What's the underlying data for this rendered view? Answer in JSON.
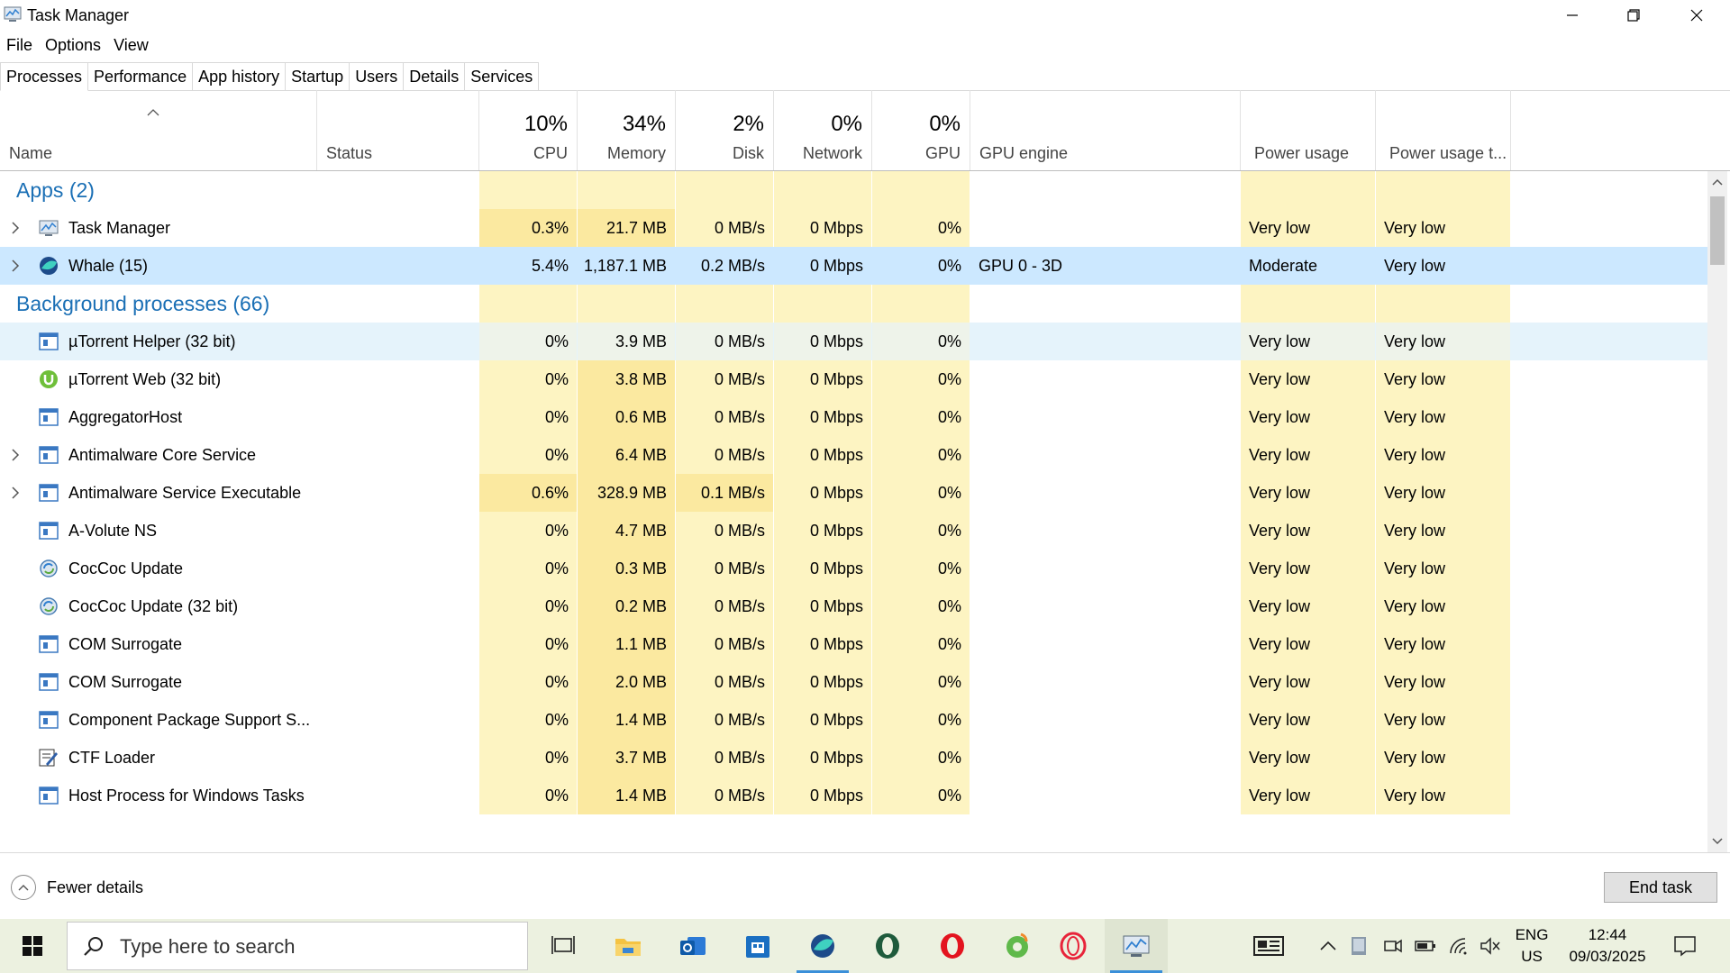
{
  "window": {
    "title": "Task Manager"
  },
  "menu": [
    "File",
    "Options",
    "View"
  ],
  "tabs": [
    "Processes",
    "Performance",
    "App history",
    "Startup",
    "Users",
    "Details",
    "Services"
  ],
  "columns": {
    "name": "Name",
    "status": "Status",
    "cpu": {
      "pct": "10%",
      "label": "CPU"
    },
    "memory": {
      "pct": "34%",
      "label": "Memory"
    },
    "disk": {
      "pct": "2%",
      "label": "Disk"
    },
    "network": {
      "pct": "0%",
      "label": "Network"
    },
    "gpu": {
      "pct": "0%",
      "label": "GPU"
    },
    "gpu_engine": "GPU engine",
    "power": "Power usage",
    "power_trend": "Power usage t..."
  },
  "groups": {
    "apps": "Apps (2)",
    "background": "Background processes (66)"
  },
  "apps": [
    {
      "name": "Task Manager",
      "icon": "task-manager-icon",
      "expandable": true,
      "cpu": "0.3%",
      "mem": "21.7 MB",
      "disk": "0 MB/s",
      "net": "0 Mbps",
      "gpu": "0%",
      "engine": "",
      "power": "Very low",
      "trend": "Very low"
    },
    {
      "name": "Whale (15)",
      "icon": "whale-browser-icon",
      "expandable": true,
      "selected": true,
      "cpu": "5.4%",
      "mem": "1,187.1 MB",
      "disk": "0.2 MB/s",
      "net": "0 Mbps",
      "gpu": "0%",
      "engine": "GPU 0 - 3D",
      "power": "Moderate",
      "trend": "Very low"
    }
  ],
  "background": [
    {
      "name": "µTorrent Helper (32 bit)",
      "icon": "service-window-icon",
      "expandable": false,
      "hover": true,
      "cpu": "0%",
      "mem": "3.9 MB",
      "disk": "0 MB/s",
      "net": "0 Mbps",
      "gpu": "0%",
      "engine": "",
      "power": "Very low",
      "trend": "Very low"
    },
    {
      "name": "µTorrent Web (32 bit)",
      "icon": "utorrent-icon",
      "expandable": false,
      "cpu": "0%",
      "mem": "3.8 MB",
      "disk": "0 MB/s",
      "net": "0 Mbps",
      "gpu": "0%",
      "engine": "",
      "power": "Very low",
      "trend": "Very low"
    },
    {
      "name": "AggregatorHost",
      "icon": "service-window-icon",
      "expandable": false,
      "cpu": "0%",
      "mem": "0.6 MB",
      "disk": "0 MB/s",
      "net": "0 Mbps",
      "gpu": "0%",
      "engine": "",
      "power": "Very low",
      "trend": "Very low"
    },
    {
      "name": "Antimalware Core Service",
      "icon": "service-window-icon",
      "expandable": true,
      "cpu": "0%",
      "mem": "6.4 MB",
      "disk": "0 MB/s",
      "net": "0 Mbps",
      "gpu": "0%",
      "engine": "",
      "power": "Very low",
      "trend": "Very low"
    },
    {
      "name": "Antimalware Service Executable",
      "icon": "service-window-icon",
      "expandable": true,
      "cpu": "0.6%",
      "mem": "328.9 MB",
      "disk": "0.1 MB/s",
      "net": "0 Mbps",
      "gpu": "0%",
      "engine": "",
      "power": "Very low",
      "trend": "Very low"
    },
    {
      "name": "A-Volute NS",
      "icon": "service-window-icon",
      "expandable": false,
      "cpu": "0%",
      "mem": "4.7 MB",
      "disk": "0 MB/s",
      "net": "0 Mbps",
      "gpu": "0%",
      "engine": "",
      "power": "Very low",
      "trend": "Very low"
    },
    {
      "name": "CocCoc Update",
      "icon": "updater-icon",
      "expandable": false,
      "cpu": "0%",
      "mem": "0.3 MB",
      "disk": "0 MB/s",
      "net": "0 Mbps",
      "gpu": "0%",
      "engine": "",
      "power": "Very low",
      "trend": "Very low"
    },
    {
      "name": "CocCoc Update (32 bit)",
      "icon": "updater-icon",
      "expandable": false,
      "cpu": "0%",
      "mem": "0.2 MB",
      "disk": "0 MB/s",
      "net": "0 Mbps",
      "gpu": "0%",
      "engine": "",
      "power": "Very low",
      "trend": "Very low"
    },
    {
      "name": "COM Surrogate",
      "icon": "service-window-icon",
      "expandable": false,
      "cpu": "0%",
      "mem": "1.1 MB",
      "disk": "0 MB/s",
      "net": "0 Mbps",
      "gpu": "0%",
      "engine": "",
      "power": "Very low",
      "trend": "Very low"
    },
    {
      "name": "COM Surrogate",
      "icon": "service-window-icon",
      "expandable": false,
      "cpu": "0%",
      "mem": "2.0 MB",
      "disk": "0 MB/s",
      "net": "0 Mbps",
      "gpu": "0%",
      "engine": "",
      "power": "Very low",
      "trend": "Very low"
    },
    {
      "name": "Component Package Support S...",
      "icon": "service-window-icon",
      "expandable": false,
      "cpu": "0%",
      "mem": "1.4 MB",
      "disk": "0 MB/s",
      "net": "0 Mbps",
      "gpu": "0%",
      "engine": "",
      "power": "Very low",
      "trend": "Very low"
    },
    {
      "name": "CTF Loader",
      "icon": "ctf-pen-icon",
      "expandable": false,
      "cpu": "0%",
      "mem": "3.7 MB",
      "disk": "0 MB/s",
      "net": "0 Mbps",
      "gpu": "0%",
      "engine": "",
      "power": "Very low",
      "trend": "Very low"
    },
    {
      "name": "Host Process for Windows Tasks",
      "icon": "service-window-icon",
      "expandable": false,
      "cpu": "0%",
      "mem": "1.4 MB",
      "disk": "0 MB/s",
      "net": "0 Mbps",
      "gpu": "0%",
      "engine": "",
      "power": "Very low",
      "trend": "Very low"
    }
  ],
  "footer": {
    "fewer_details": "Fewer details",
    "end_task": "End task"
  },
  "taskbar": {
    "search_placeholder": "Type here to search",
    "apps": [
      "task-view-icon",
      "file-explorer-icon",
      "outlook-icon",
      "store-icon",
      "whale-browser-icon",
      "opera-gx-icon",
      "opera-icon",
      "coccoc-icon",
      "opera-red-icon",
      "task-manager-icon"
    ],
    "lang": "ENG",
    "region": "US",
    "time": "12:44",
    "date": "09/03/2025"
  },
  "colors": {
    "accent": "#1a6fb5",
    "cell_light": "#fdf4c2",
    "cell_dark": "#fbe9a0",
    "selected": "#cce8ff"
  }
}
